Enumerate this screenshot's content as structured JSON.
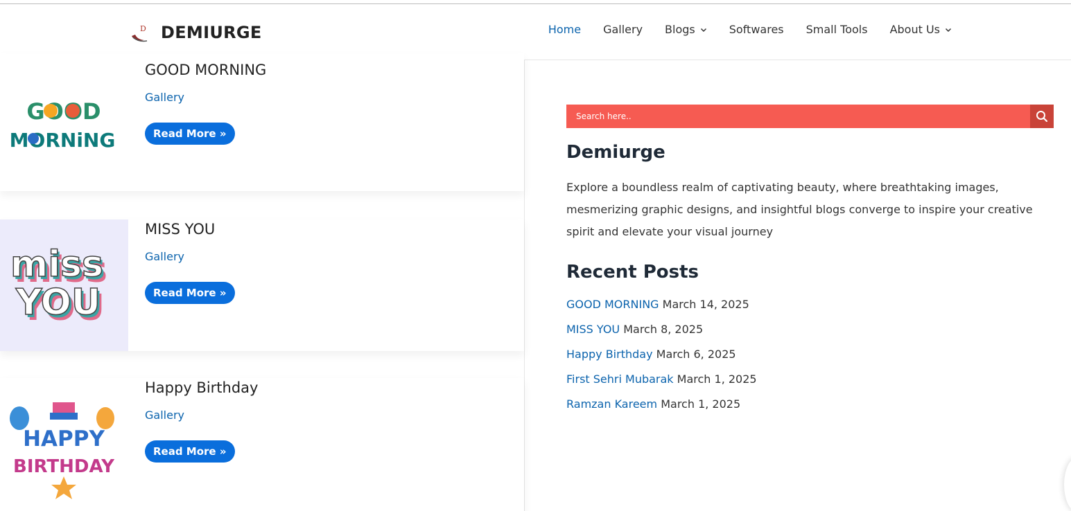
{
  "brand": {
    "name": "DEMIURGE",
    "logo_letter": "D"
  },
  "nav": {
    "items": [
      {
        "label": "Home",
        "active": true,
        "dropdown": false
      },
      {
        "label": "Gallery",
        "active": false,
        "dropdown": false
      },
      {
        "label": "Blogs",
        "active": false,
        "dropdown": true
      },
      {
        "label": "Softwares",
        "active": false,
        "dropdown": false
      },
      {
        "label": "Small Tools",
        "active": false,
        "dropdown": false
      },
      {
        "label": "About Us",
        "active": false,
        "dropdown": true
      }
    ]
  },
  "posts": [
    {
      "title": "GOOD MORNING",
      "category": "Gallery",
      "read_more": "Read More »",
      "image": "good-morning-illustration"
    },
    {
      "title": "MISS YOU",
      "category": "Gallery",
      "read_more": "Read More »",
      "image": "miss-you-illustration"
    },
    {
      "title": "Happy Birthday",
      "category": "Gallery",
      "read_more": "Read More »",
      "image": "happy-birthday-illustration"
    }
  ],
  "sidebar": {
    "search_placeholder": "Search here..",
    "site_title": "Demiurge",
    "site_description": "Explore a boundless realm of captivating beauty, where breathtaking images, mesmerizing graphic designs, and insightful blogs converge to inspire your creative spirit and elevate your visual journey",
    "recent_posts_title": "Recent Posts",
    "recent_posts": [
      {
        "title": "GOOD MORNING",
        "date": "March 14, 2025"
      },
      {
        "title": "MISS YOU",
        "date": "March 8, 2025"
      },
      {
        "title": "Happy Birthday",
        "date": "March 6, 2025"
      },
      {
        "title": "First Sehri Mubarak",
        "date": "March 1, 2025"
      },
      {
        "title": "Ramzan Kareem",
        "date": "March 1, 2025"
      }
    ]
  },
  "colors": {
    "accent": "#0b63ad",
    "button": "#0a6edc",
    "search_bg": "#f65b52",
    "search_button": "#c94338"
  },
  "thumb_words": {
    "good_1": "GOOD",
    "good_2": "MORNiNG",
    "miss_1": "miss",
    "miss_2": "YOU",
    "bday_1": "HAPPY",
    "bday_2": "BIRTHDAY"
  }
}
